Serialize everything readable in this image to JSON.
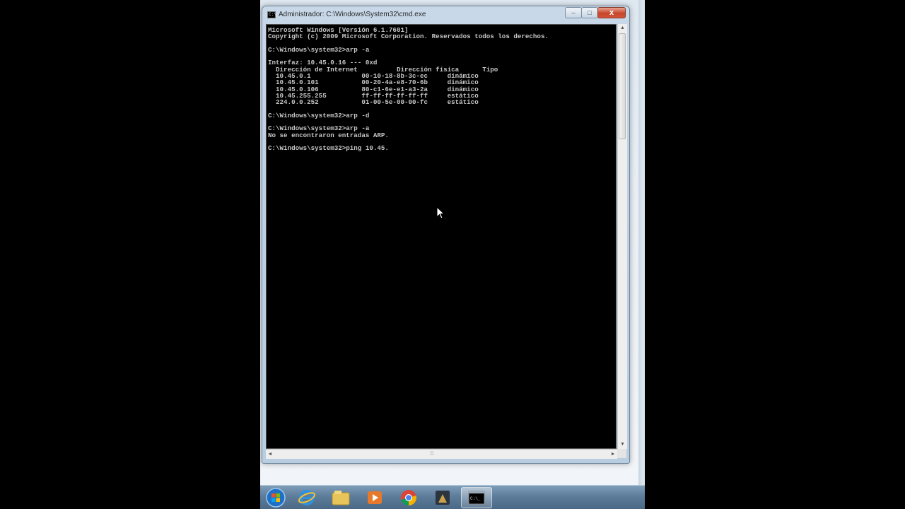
{
  "window": {
    "title": "Administrador: C:\\Windows\\System32\\cmd.exe",
    "minimize_label": "–",
    "maximize_label": "□",
    "close_label": "x"
  },
  "console": {
    "lines": [
      "Microsoft Windows [Versión 6.1.7601]",
      "Copyright (c) 2009 Microsoft Corporation. Reservados todos los derechos.",
      "",
      "C:\\Windows\\system32>arp -a",
      "",
      "Interfaz: 10.45.0.16 --- 0xd",
      "  Dirección de Internet          Dirección física      Tipo",
      "  10.45.0.1             00-10-18-8b-3c-ec     dinámico",
      "  10.45.0.101           00-20-4a-e8-70-6b     dinámico",
      "  10.45.0.106           80-c1-6e-e1-a3-2a     dinámico",
      "  10.45.255.255         ff-ff-ff-ff-ff-ff     estático",
      "  224.0.0.252           01-00-5e-00-00-fc     estático",
      "",
      "C:\\Windows\\system32>arp -d",
      "",
      "C:\\Windows\\system32>arp -a",
      "No se encontraron entradas ARP.",
      "",
      "C:\\Windows\\system32>ping 10.45."
    ]
  },
  "taskbar": {
    "items": [
      {
        "icon": "start-orb-icon",
        "color": "#1f6fc6"
      },
      {
        "icon": "internet-explorer-icon",
        "color": "#2f8fe0"
      },
      {
        "icon": "file-explorer-icon",
        "color": "#e8c55a"
      },
      {
        "icon": "media-player-icon",
        "color": "#e8792a"
      },
      {
        "icon": "chrome-icon",
        "color": "#db4437"
      },
      {
        "icon": "recorder-app-icon",
        "color": "#c9a24a"
      },
      {
        "icon": "cmd-icon",
        "color": "#000000",
        "active": true
      }
    ]
  },
  "colors": {
    "console_bg": "#000000",
    "console_fg": "#c6c6c6",
    "taskbar": "#5c7c9a"
  }
}
